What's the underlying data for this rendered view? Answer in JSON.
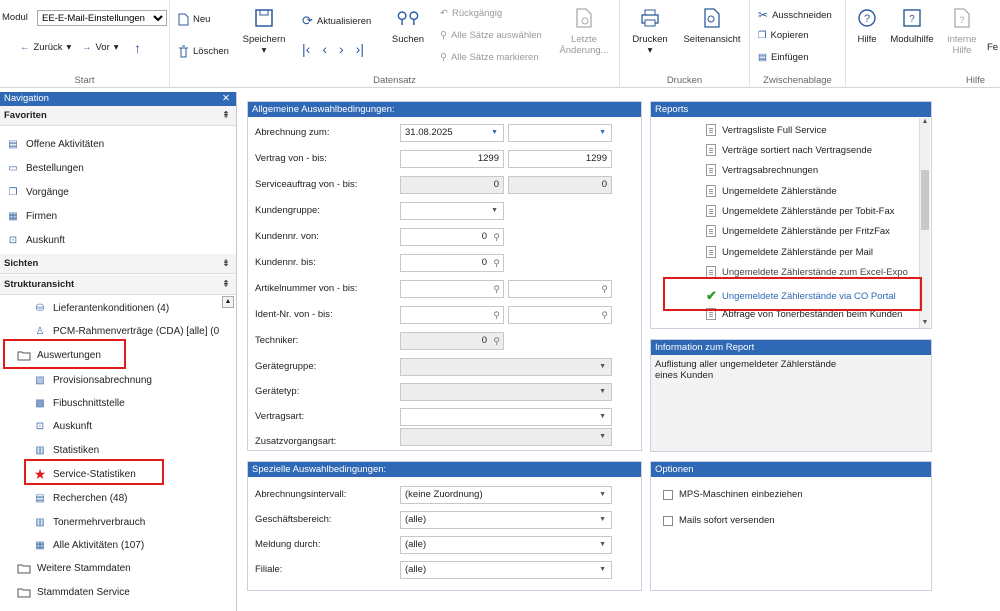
{
  "ribbon": {
    "module_label": "Modul",
    "module_value": "EE-E-Mail-Einstellungen",
    "back_label": "Zurück",
    "forward_label": "Vor",
    "start_group": "Start",
    "neu": "Neu",
    "loeschen": "Löschen",
    "speichern": "Speichern",
    "aktualisieren": "Aktualisieren",
    "suchen": "Suchen",
    "rueckgaengig": "Rückgängig",
    "alle_auswaehlen": "Alle Sätze auswählen",
    "alle_markieren": "Alle Sätze markieren",
    "letzte_aenderung": "Letzte Änderung...",
    "datensatz_group": "Datensatz",
    "drucken": "Drucken",
    "seitenansicht": "Seitenansicht",
    "drucken_group": "Drucken",
    "ausschneiden": "Ausschneiden",
    "kopieren": "Kopieren",
    "einfuegen": "Einfügen",
    "zwischenablage_group": "Zwischenablage",
    "hilfe": "Hilfe",
    "modulhilfe": "Modulhilfe",
    "interne_hilfe": "interne Hilfe",
    "fe": "Fe",
    "hilfe_group": "Hilfe"
  },
  "nav": {
    "title": "Navigation",
    "favoriten": "Favoriten",
    "fav_items": [
      "Offene Aktivitäten",
      "Bestellungen",
      "Vorgänge",
      "Firmen",
      "Auskunft"
    ],
    "sichten": "Sichten",
    "struktur": "Strukturansicht",
    "struct_items": [
      "Lieferantenkonditionen (4)",
      "PCM-Rahmenverträge (CDA) [alle] (0"
    ],
    "auswertungen": "Auswertungen",
    "sub_items": [
      "Provisionsabrechnung",
      "Fibuschnittstelle",
      "Auskunft",
      "Statistiken",
      "Service-Statistiken",
      "Recherchen (48)",
      "Tonermehrverbrauch",
      "Alle Aktivitäten (107)"
    ],
    "folders": [
      "Weitere Stammdaten",
      "Stammdaten Service"
    ]
  },
  "allgemein": {
    "title": "Allgemeine Auswahlbedingungen:",
    "abrechnung_label": "Abrechnung zum:",
    "abrechnung_value": "31.08.2025",
    "vertrag_label": "Vertrag von - bis:",
    "vertrag_von": "1299",
    "vertrag_bis": "1299",
    "service_label": "Serviceauftrag von - bis:",
    "service_von": "0",
    "service_bis": "0",
    "kundengruppe_label": "Kundengruppe:",
    "kundennr_von_label": "Kundennr. von:",
    "kundennr_von": "0",
    "kundennr_bis_label": "Kundennr. bis:",
    "kundennr_bis": "0",
    "artikel_label": "Artikelnummer von - bis:",
    "ident_label": "Ident-Nr. von - bis:",
    "techniker_label": "Techniker:",
    "techniker_value": "0",
    "geraetegruppe_label": "Gerätegruppe:",
    "geraetetyp_label": "Gerätetyp:",
    "vertragsart_label": "Vertragsart:",
    "zusatz_label": "Zusatzvorgangsart:"
  },
  "speziell": {
    "title": "Spezielle Auswahlbedingungen:",
    "rows": [
      {
        "label": "Abrechnungsintervall:",
        "value": "(keine Zuordnung)"
      },
      {
        "label": "Geschäftsbereich:",
        "value": "(alle)"
      },
      {
        "label": "Meldung durch:",
        "value": "(alle)"
      },
      {
        "label": "Filiale:",
        "value": "(alle)"
      }
    ]
  },
  "reports": {
    "title": "Reports",
    "items": [
      "Vertragsliste Full Service",
      "Verträge sortiert nach Vertragsende",
      "Vertragsabrechnungen",
      "Ungemeldete Zählerstände",
      "Ungemeldete Zählerstände per Tobit-Fax",
      "Ungemeldete Zählerstände per FritzFax",
      "Ungemeldete Zählerstände per Mail",
      "Ungemeldete Zählerstände zum Excel-Expo",
      "Ungemeldete Zählerstände via CO Portal",
      "Abfrage von Tonerbeständen beim Kunden"
    ]
  },
  "info": {
    "title": "Information zum Report",
    "text1": "Auflistung aller ungemeldeter Zählerstände",
    "text2": "eines Kunden"
  },
  "optionen": {
    "title": "Optionen",
    "opt1": "MPS-Maschinen einbeziehen",
    "opt2": "Mails sofort versenden"
  },
  "colors": {
    "accent": "#2f68b5",
    "highlight_red": "#e01b1b",
    "check_green": "#2e9a2e"
  }
}
